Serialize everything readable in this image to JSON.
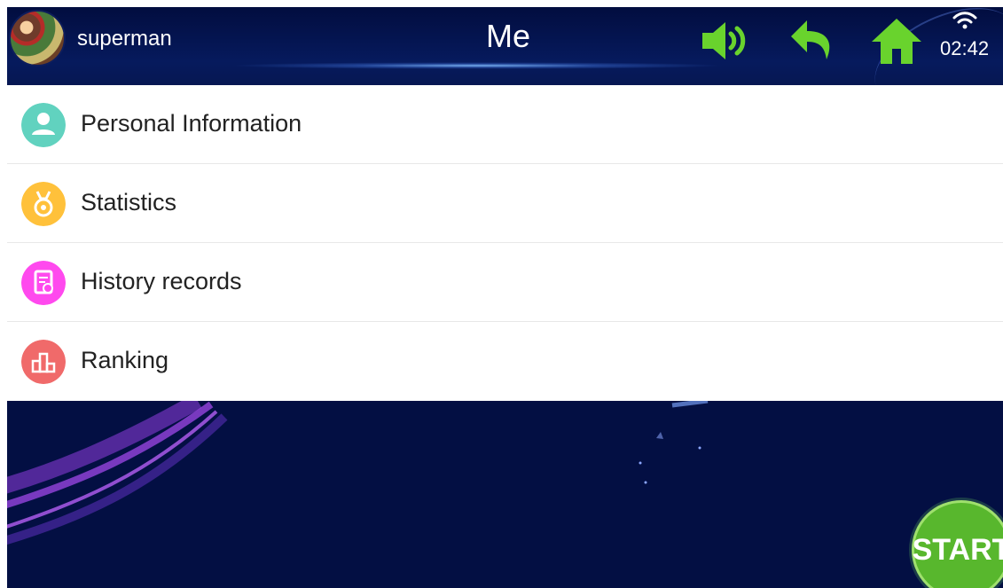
{
  "header": {
    "username": "superman",
    "title": "Me",
    "icons": {
      "sound": "speaker-icon",
      "back": "back-arrow-icon",
      "home": "home-icon"
    },
    "status": {
      "time": "02:42",
      "wifi": "wifi-icon"
    }
  },
  "menu": {
    "items": [
      {
        "label": "Personal Information",
        "icon": "user-icon",
        "color": "#61d2bf"
      },
      {
        "label": "Statistics",
        "icon": "medal-icon",
        "color": "#ffc13b"
      },
      {
        "label": "History records",
        "icon": "history-icon",
        "color": "#ff49ee"
      },
      {
        "label": "Ranking",
        "icon": "ranking-icon",
        "color": "#f06a6a"
      }
    ]
  },
  "actions": {
    "start_label": "START"
  },
  "colors": {
    "header_bg": "#061752",
    "accent_green": "#69d32d",
    "page_bg": "#030f43"
  }
}
